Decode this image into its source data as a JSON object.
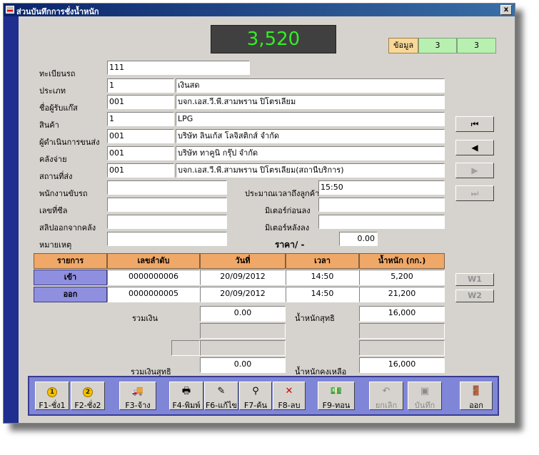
{
  "window": {
    "title": "ส่วนบันทึกการชั่งน้ำหนัก",
    "close_label": "x"
  },
  "display": {
    "weight": "3,520"
  },
  "info": {
    "label": "ข้อมูล",
    "values": [
      "3",
      "3"
    ]
  },
  "form": {
    "plate": {
      "label": "ทะเบียนรถ",
      "code": "111"
    },
    "type": {
      "label": "ประเภท",
      "code": "1",
      "name": "เงินสด"
    },
    "receiver": {
      "label": "ชื่อผู้รับแก๊ส",
      "code": "001",
      "name": "บจก.เอส.วี.พี.สามพราน ปิโตรเลียม"
    },
    "product": {
      "label": "สินค้า",
      "code": "1",
      "name": "LPG"
    },
    "transporter": {
      "label": "ผู้ดำเนินการขนส่ง",
      "code": "001",
      "name": "บริษัท ลินเก้ส โลจิสติกส์ จำกัด"
    },
    "warehouse": {
      "label": "คลังจ่าย",
      "code": "001",
      "name": "บริษัท ทาคูนิ กรุ๊ป จำกัด"
    },
    "ship_to": {
      "label": "สถานที่ส่ง",
      "code": "001",
      "name": "บจก.เอส.วี.พี.สามพราน ปิโตรเลียม(สถานีบริการ)"
    },
    "driver": {
      "label": "พนักงานขับรถ",
      "value": ""
    },
    "seal": {
      "label": "เลขที่ซีล",
      "value": ""
    },
    "slip": {
      "label": "สลิปออกจากคลัง",
      "value": ""
    },
    "note": {
      "label": "หมายเหตุ",
      "value": ""
    },
    "eta": {
      "label": "ประมาณเวลาถึงลูกค้า",
      "value": "15:50"
    },
    "meter_before": {
      "label": "มิเตอร์ก่อนลง",
      "value": ""
    },
    "meter_after": {
      "label": "มิเตอร์หลังลง",
      "value": ""
    },
    "price": {
      "label": "ราคา/ -",
      "value": "0.00"
    }
  },
  "nav": {
    "first": "⏮",
    "prev": "◀",
    "next": "▶",
    "last": "⏭"
  },
  "weigh_buttons": {
    "w1": "W1",
    "w2": "W2"
  },
  "table": {
    "headers": [
      "รายการ",
      "เลขลำดับ",
      "วันที่",
      "เวลา",
      "น้ำหนัก (กก.)"
    ],
    "rows": [
      {
        "label": "เข้า",
        "seq": "0000000006",
        "date": "20/09/2012",
        "time": "14:50",
        "weight": "5,200"
      },
      {
        "label": "ออก",
        "seq": "0000000005",
        "date": "20/09/2012",
        "time": "14:50",
        "weight": "21,200"
      }
    ]
  },
  "totals": {
    "total_money_label": "รวมเงิน",
    "total_money": "0.00",
    "net_weight_label": "น้ำหนักสุทธิ",
    "net_weight": "16,000",
    "net_money_label": "รวมเงินสุทธิ",
    "net_money": "0.00",
    "remaining_weight_label": "น้ำหนักคงเหลือ",
    "remaining_weight": "16,000"
  },
  "toolbar": {
    "f1": "F1-ชั่ง1",
    "f2": "F2-ชั่ง2",
    "f3": "F3-จ้าง",
    "f4": "F4-พิมพ์",
    "f6": "F6-แก้ไข",
    "f7": "F7-ค้น",
    "f8": "F8-ลบ",
    "f9": "F9-ทอน",
    "cancel": "ยกเลิก",
    "save": "บันทึก",
    "exit": "ออก",
    "coin1": "1",
    "coin2": "2"
  }
}
